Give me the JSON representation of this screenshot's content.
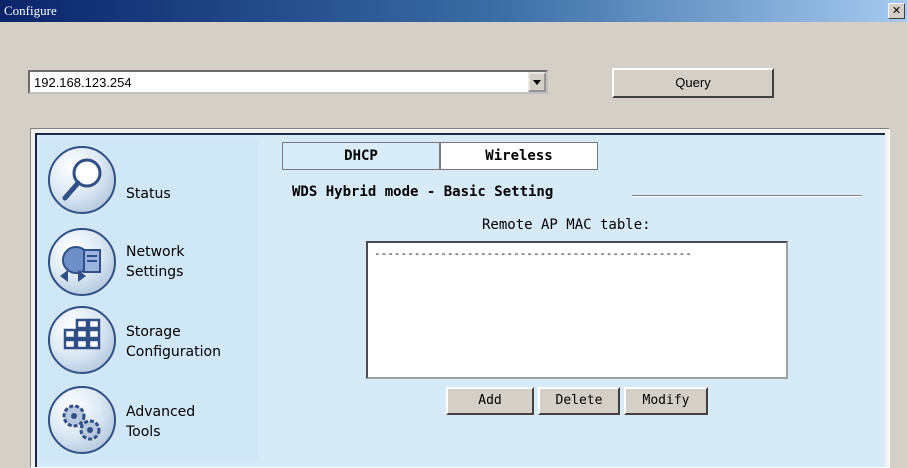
{
  "window": {
    "title": "Configure",
    "close_label": "✕"
  },
  "host_combo": {
    "value": "192.168.123.254"
  },
  "toolbar": {
    "query_label": "Query"
  },
  "sidebar": {
    "items": [
      {
        "label": "Status",
        "icon": "magnifier-icon"
      },
      {
        "label": "Network\nSettings",
        "icon": "network-icon"
      },
      {
        "label": "Storage\nConfiguration",
        "icon": "storage-grid-icon"
      },
      {
        "label": "Advanced\nTools",
        "icon": "gears-icon"
      }
    ]
  },
  "tabs": [
    {
      "label": "DHCP",
      "selected": false
    },
    {
      "label": "Wireless",
      "selected": true
    }
  ],
  "main": {
    "section_title": "WDS Hybrid mode - Basic Setting",
    "table_label": "Remote AP MAC table:",
    "table_rows": [
      "------------------------------------------------"
    ],
    "buttons": {
      "add": "Add",
      "delete": "Delete",
      "modify": "Modify"
    }
  },
  "colors": {
    "panel_bg": "#d6eaf8",
    "titlebar": "#0a246a"
  }
}
